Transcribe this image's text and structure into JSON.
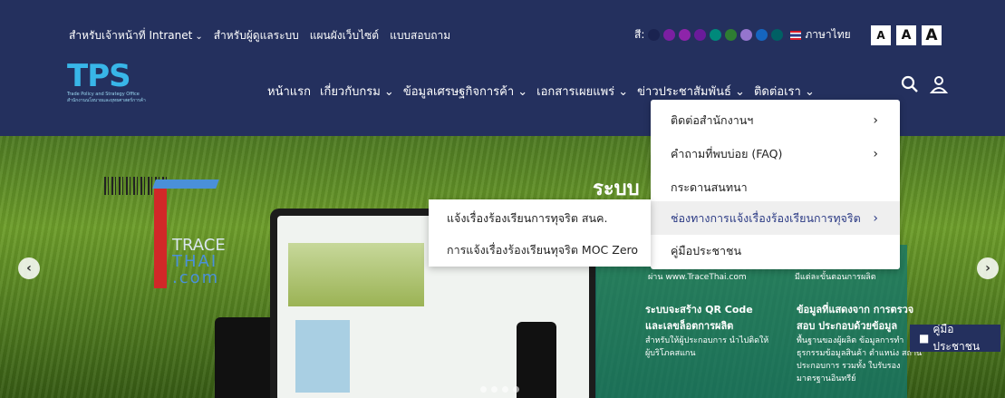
{
  "utility_nav": {
    "links": [
      "สำหรับเจ้าหน้าที่ Intranet",
      "สำหรับผู้ดูแลระบบ",
      "แผนผังเว็บไซต์",
      "แบบสอบถาม"
    ],
    "color_label": "สี:",
    "color_swatches": [
      "#1a2350",
      "#7b1fa2",
      "#8e24aa",
      "#6a1b9a",
      "#00897b",
      "#2e7d32",
      "#9575cd",
      "#1565c0",
      "#006064"
    ],
    "language": "ภาษาไทย",
    "font_sizes": [
      "A",
      "A",
      "A"
    ]
  },
  "logo": {
    "text": "TPS",
    "line1": "Trade Policy and Strategy Office",
    "line2": "สำนักงานนโยบายและยุทธศาสตร์การค้า"
  },
  "main_nav": [
    "หน้าแรก",
    "เกี่ยวกับกรม",
    "ข้อมูลเศรษฐกิจการค้า",
    "เอกสารเผยแพร่",
    "ข่าวประชาสัมพันธ์",
    "ติดต่อเรา"
  ],
  "dropdown": {
    "items": [
      {
        "label": "ติดต่อสำนักงานฯ",
        "has_sub": true
      },
      {
        "label": "คำถามที่พบบ่อย (FAQ)",
        "has_sub": true
      },
      {
        "label": "กระดานสนทนา",
        "has_sub": false
      },
      {
        "label": "ช่องทางการแจ้งเรื่องร้องเรียนการทุจริต",
        "has_sub": true
      },
      {
        "label": "คู่มือประชาชน",
        "has_sub": false
      }
    ]
  },
  "submenu": {
    "items": [
      "แจ้งเรื่องร้องเรียนการทุจริต สนค.",
      "การแจ้งเรื่องร้องเรียนทุจริต MOC Zero"
    ]
  },
  "hero": {
    "title": "ระบบ",
    "trace_line1": "TRACE",
    "trace_line2": "THAI",
    "trace_line3": ".com",
    "panel": {
      "top_left": "ผ่าน www.TraceThai.com",
      "top_right": "มีแต่ละขั้นตอนการผลิต",
      "b3_title": "ระบบจะสร้าง QR Code และเลขล็อตการผลิต",
      "b3_text": "สำหรับให้ผู้ประกอบการ นำไปติดให้ผู้บริโภคสแกน",
      "b4_title": "ข้อมูลที่แสดงจาก การตรวจสอบ ประกอบด้วยข้อมูล",
      "b4_text": "พื้นฐานของผู้ผลิต ข้อมูลการทำ ธุรกรรมข้อมูลสินค้า ตำแหน่ง สถานประกอบการ รวมทั้ง ใบรับรองมาตรฐานอินทรีย์"
    },
    "handbook_label": "คู่มือประชาชน"
  }
}
